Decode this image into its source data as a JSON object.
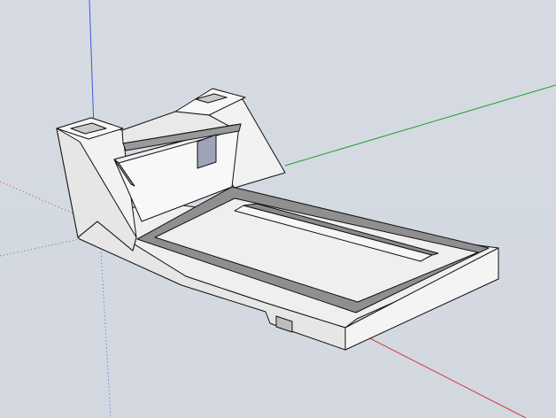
{
  "scene": {
    "axis_colors": {
      "blue": "#3b5bdb",
      "green": "#1f9d2a",
      "red": "#d23b3b"
    },
    "model": {
      "face_light": "#f4f4f4",
      "face_mid": "#e7e7e7",
      "face_dark": "#bcbcbc",
      "face_shadow": "#8a8a8a",
      "edge": "#111111"
    }
  }
}
